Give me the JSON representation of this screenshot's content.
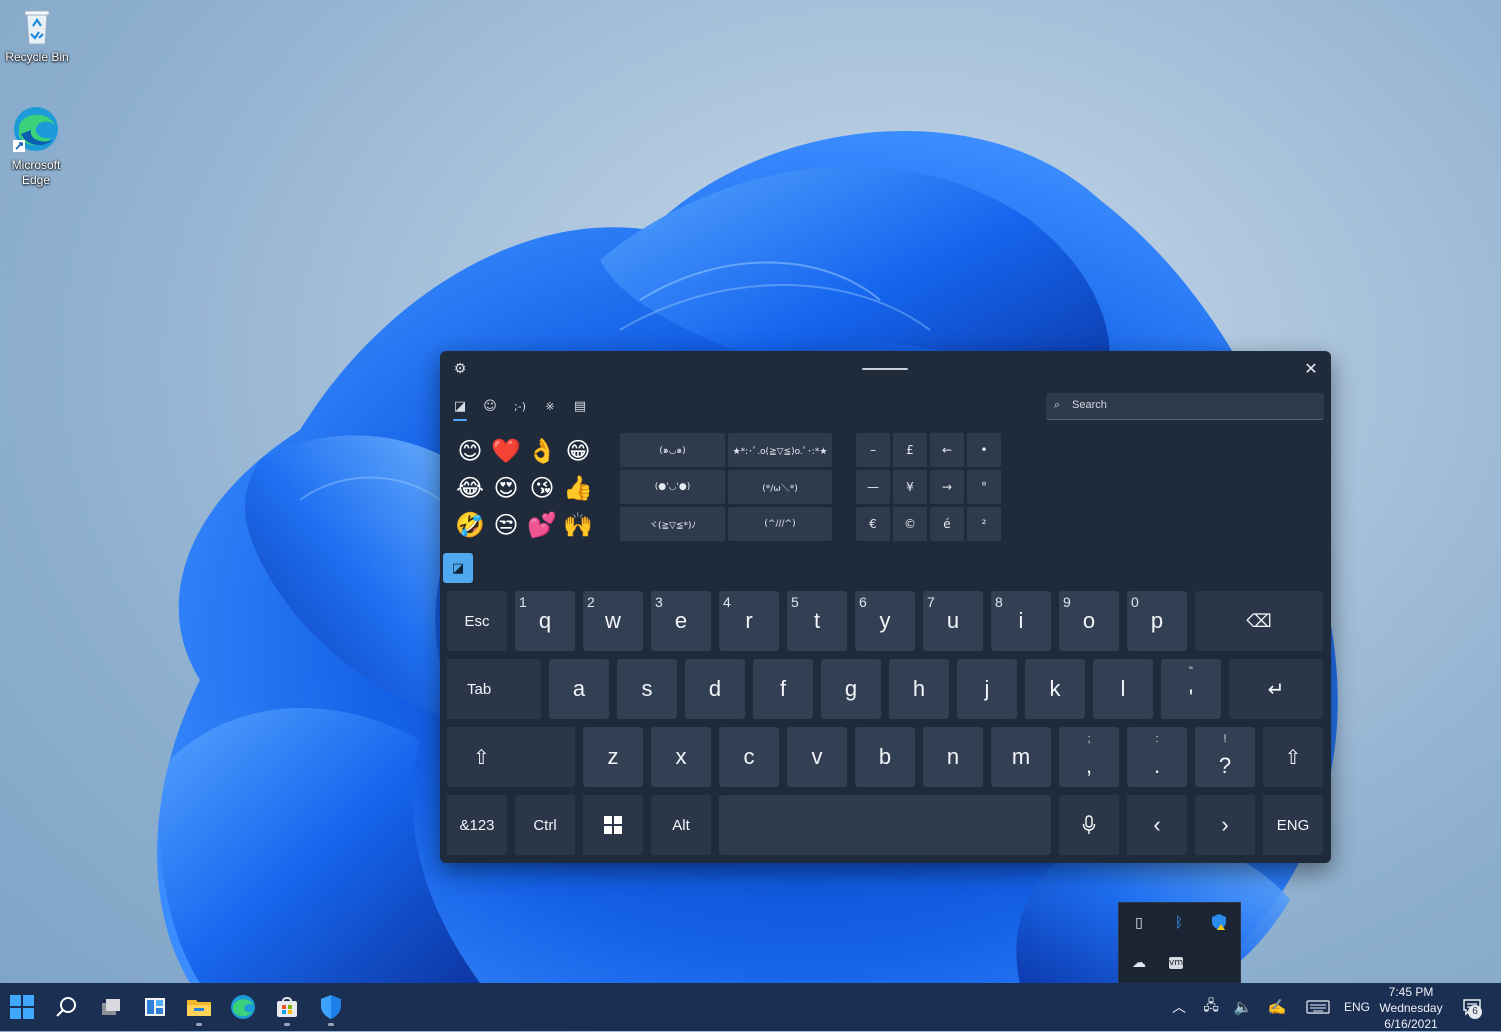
{
  "desktop": {
    "icons": [
      {
        "label": "Recycle Bin"
      },
      {
        "label": "Microsoft Edge"
      }
    ]
  },
  "keyboard": {
    "search_placeholder": "Search",
    "tabs": [
      "recent-icon",
      "emoji-icon",
      "kaomoji-icon",
      "symbols-icon",
      "clipboard-icon"
    ],
    "emoji": [
      "😊",
      "❤️",
      "👌",
      "😁",
      "😂",
      "😍",
      "😘",
      "👍",
      "🤣",
      "😒",
      "💕",
      "🙌"
    ],
    "kaomoji": [
      "(๑◡๑)",
      "★*:･ﾟ.o(≧▽≦)o.ﾟ･:*★",
      "(●'◡'●)",
      "(*/ω＼*)",
      "ヾ(≧▽≦*)ﾉ",
      "(^///^)"
    ],
    "symbols": [
      "–",
      "£",
      "←",
      "•",
      "—",
      "¥",
      "→",
      "°",
      "€",
      "©",
      "é",
      "²"
    ],
    "rows": {
      "row1": [
        {
          "label": "Esc"
        },
        {
          "num": "1",
          "label": "q"
        },
        {
          "num": "2",
          "label": "w"
        },
        {
          "num": "3",
          "label": "e"
        },
        {
          "num": "4",
          "label": "r"
        },
        {
          "num": "5",
          "label": "t"
        },
        {
          "num": "6",
          "label": "y"
        },
        {
          "num": "7",
          "label": "u"
        },
        {
          "num": "8",
          "label": "i"
        },
        {
          "num": "9",
          "label": "o"
        },
        {
          "num": "0",
          "label": "p"
        },
        {
          "label": "⌫"
        }
      ],
      "row2": [
        {
          "label": "Tab"
        },
        {
          "label": "a"
        },
        {
          "label": "s"
        },
        {
          "label": "d"
        },
        {
          "label": "f"
        },
        {
          "label": "g"
        },
        {
          "label": "h"
        },
        {
          "label": "j"
        },
        {
          "label": "k"
        },
        {
          "label": "l"
        },
        {
          "sub": "\"",
          "label": "'"
        },
        {
          "label": "↵"
        }
      ],
      "row3": [
        {
          "label": "⇧"
        },
        {
          "label": "z"
        },
        {
          "label": "x"
        },
        {
          "label": "c"
        },
        {
          "label": "v"
        },
        {
          "label": "b"
        },
        {
          "label": "n"
        },
        {
          "label": "m"
        },
        {
          "sub": ";",
          "label": ","
        },
        {
          "sub": ":",
          "label": "."
        },
        {
          "sub": "!",
          "label": "?"
        },
        {
          "label": "⇧"
        }
      ],
      "row4": [
        {
          "label": "&123"
        },
        {
          "label": "Ctrl"
        },
        {
          "label": "windows-icon"
        },
        {
          "label": "Alt"
        },
        {
          "label": ""
        },
        {
          "label": "microphone-icon"
        },
        {
          "label": "‹"
        },
        {
          "label": "›"
        },
        {
          "label": "ENG"
        }
      ]
    }
  },
  "taskbar": {
    "language": "ENG",
    "time": "7:45 PM",
    "day": "Wednesday",
    "date": "6/16/2021",
    "notification_count": "6"
  }
}
